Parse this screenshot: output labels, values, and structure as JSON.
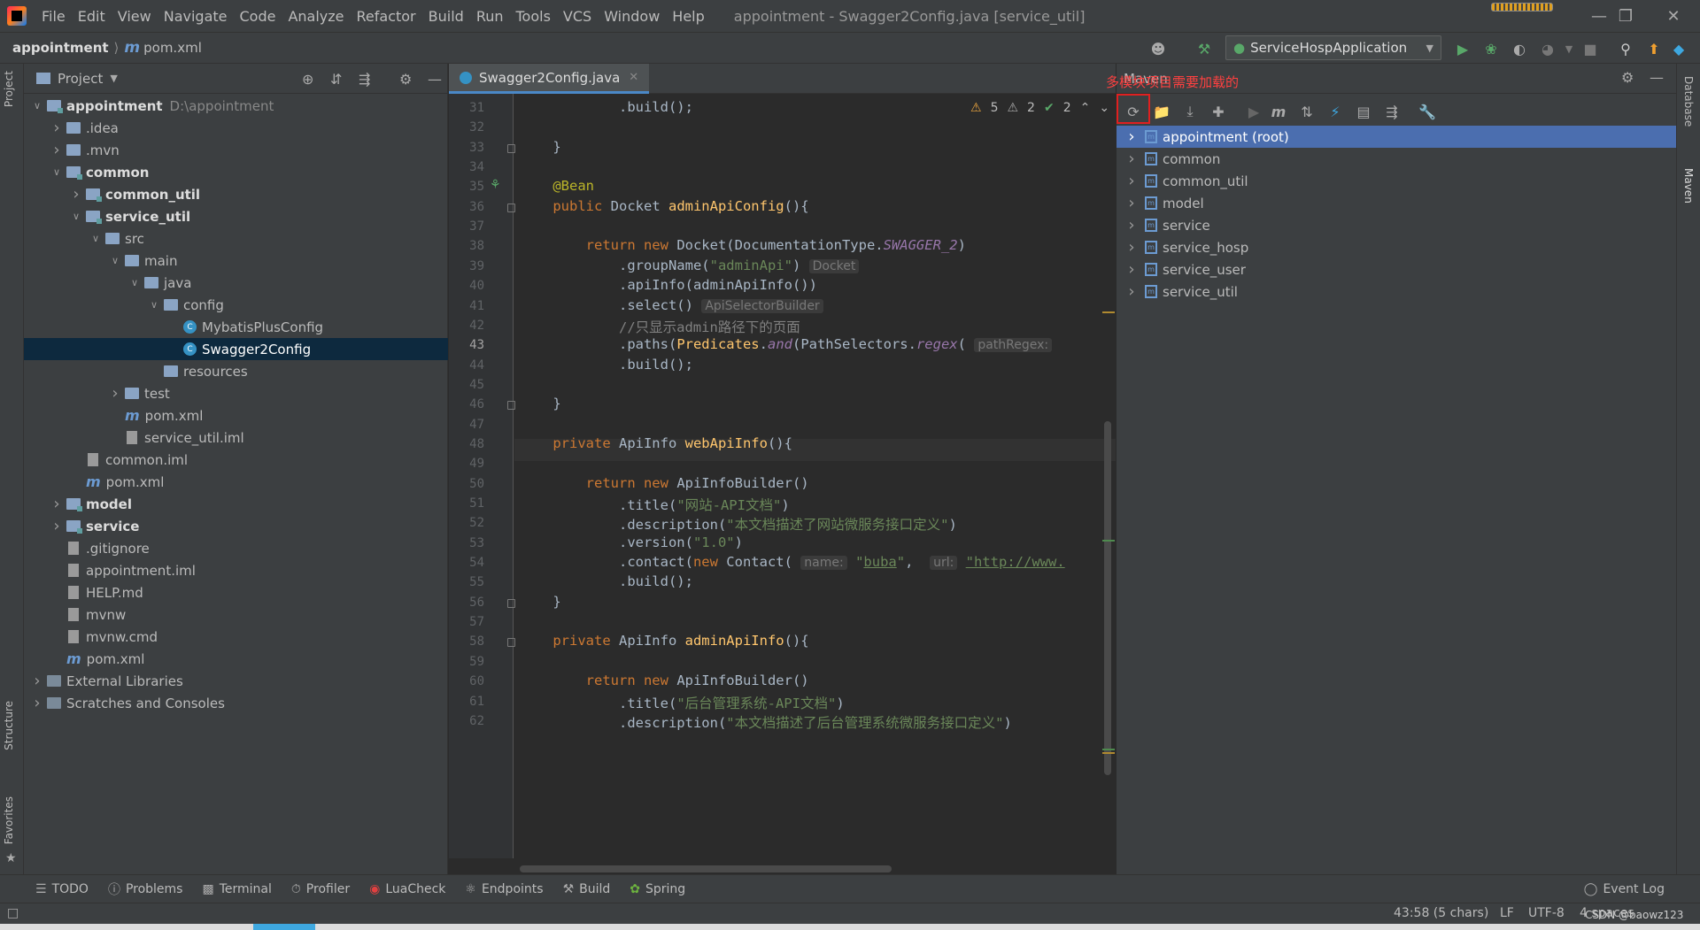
{
  "menubar": {
    "items": [
      "File",
      "Edit",
      "View",
      "Navigate",
      "Code",
      "Analyze",
      "Refactor",
      "Build",
      "Run",
      "Tools",
      "VCS",
      "Window",
      "Help"
    ],
    "title": "appointment - Swagger2Config.java [service_util]"
  },
  "navbar": {
    "breadcrumb_project": "appointment",
    "breadcrumb_file": "pom.xml",
    "run_config": "ServiceHospApplication"
  },
  "project_panel": {
    "title": "Project",
    "tree": [
      {
        "label": "appointment",
        "suffix": "D:\\appointment",
        "level": 0,
        "expanded": true,
        "kind": "module",
        "bold": true
      },
      {
        "label": ".idea",
        "level": 1,
        "expanded": false,
        "kind": "folder"
      },
      {
        "label": ".mvn",
        "level": 1,
        "expanded": false,
        "kind": "folder"
      },
      {
        "label": "common",
        "level": 1,
        "expanded": true,
        "kind": "module",
        "bold": true
      },
      {
        "label": "common_util",
        "level": 2,
        "expanded": false,
        "kind": "module",
        "bold": true
      },
      {
        "label": "service_util",
        "level": 2,
        "expanded": true,
        "kind": "module",
        "bold": true
      },
      {
        "label": "src",
        "level": 3,
        "expanded": true,
        "kind": "folder"
      },
      {
        "label": "main",
        "level": 4,
        "expanded": true,
        "kind": "folder"
      },
      {
        "label": "java",
        "level": 5,
        "expanded": true,
        "kind": "folder"
      },
      {
        "label": "config",
        "level": 6,
        "expanded": true,
        "kind": "folder"
      },
      {
        "label": "MybatisPlusConfig",
        "level": 7,
        "kind": "class"
      },
      {
        "label": "Swagger2Config",
        "level": 7,
        "kind": "class",
        "selected": true
      },
      {
        "label": "resources",
        "level": 6,
        "kind": "folder"
      },
      {
        "label": "test",
        "level": 4,
        "expanded": false,
        "kind": "folder"
      },
      {
        "label": "pom.xml",
        "level": 4,
        "kind": "maven"
      },
      {
        "label": "service_util.iml",
        "level": 4,
        "kind": "doc"
      },
      {
        "label": "common.iml",
        "level": 2,
        "kind": "doc"
      },
      {
        "label": "pom.xml",
        "level": 2,
        "kind": "maven"
      },
      {
        "label": "model",
        "level": 1,
        "expanded": false,
        "kind": "module",
        "bold": true
      },
      {
        "label": "service",
        "level": 1,
        "expanded": false,
        "kind": "module",
        "bold": true
      },
      {
        "label": ".gitignore",
        "level": 1,
        "kind": "doc"
      },
      {
        "label": "appointment.iml",
        "level": 1,
        "kind": "doc"
      },
      {
        "label": "HELP.md",
        "level": 1,
        "kind": "doc"
      },
      {
        "label": "mvnw",
        "level": 1,
        "kind": "doc"
      },
      {
        "label": "mvnw.cmd",
        "level": 1,
        "kind": "doc"
      },
      {
        "label": "pom.xml",
        "level": 1,
        "kind": "maven"
      },
      {
        "label": "External Libraries",
        "level": 0,
        "expanded": false,
        "kind": "lib"
      },
      {
        "label": "Scratches and Consoles",
        "level": 0,
        "expanded": false,
        "kind": "lib"
      }
    ]
  },
  "editor": {
    "tab_label": "Swagger2Config.java",
    "inspections": {
      "warnings": "5",
      "weak_warnings": "2",
      "ok": "2"
    },
    "current_line": 43,
    "line_numbers": [
      "31",
      "32",
      "33",
      "34",
      "35",
      "36",
      "37",
      "38",
      "39",
      "40",
      "41",
      "42",
      "43",
      "44",
      "45",
      "46",
      "47",
      "48",
      "49",
      "50",
      "51",
      "52",
      "53",
      "54",
      "55",
      "56",
      "57",
      "58",
      "59",
      "60",
      "61",
      "62"
    ]
  },
  "maven_panel": {
    "title": "Maven",
    "annotation": "多模块项目需要加载的",
    "modules": [
      "appointment (root)",
      "common",
      "common_util",
      "model",
      "service",
      "service_hosp",
      "service_user",
      "service_util"
    ]
  },
  "left_stripe": {
    "project": "Project",
    "structure": "Structure",
    "favorites": "Favorites"
  },
  "right_stripe": {
    "database": "Database",
    "maven": "Maven"
  },
  "bottom_tools": [
    "TODO",
    "Problems",
    "Terminal",
    "Profiler",
    "LuaCheck",
    "Endpoints",
    "Build",
    "Spring"
  ],
  "event_log": "Event Log",
  "status": {
    "position": "43:58 (5 chars)",
    "line_sep": "LF",
    "encoding": "UTF-8",
    "indent": "4 spaces",
    "watermark": "CSDN @baowz123"
  },
  "colors": {
    "selection": "#4b6eaf",
    "annotation_red": "#e02020",
    "keyword": "#cc7832",
    "string": "#6a8759"
  }
}
